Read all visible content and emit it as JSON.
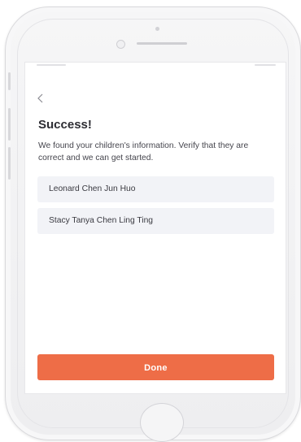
{
  "screen": {
    "title": "Success!",
    "subtitle": "We found your children's information. Verify that they are correct and we can get started.",
    "children": [
      {
        "name": "Leonard Chen Jun Huo"
      },
      {
        "name": "Stacy Tanya Chen Ling Ting"
      }
    ],
    "done_label": "Done",
    "back_icon": "chevron-left-icon"
  },
  "colors": {
    "accent": "#ee6d47",
    "card_background": "#f2f3f7",
    "title_text": "#2d2d33"
  }
}
